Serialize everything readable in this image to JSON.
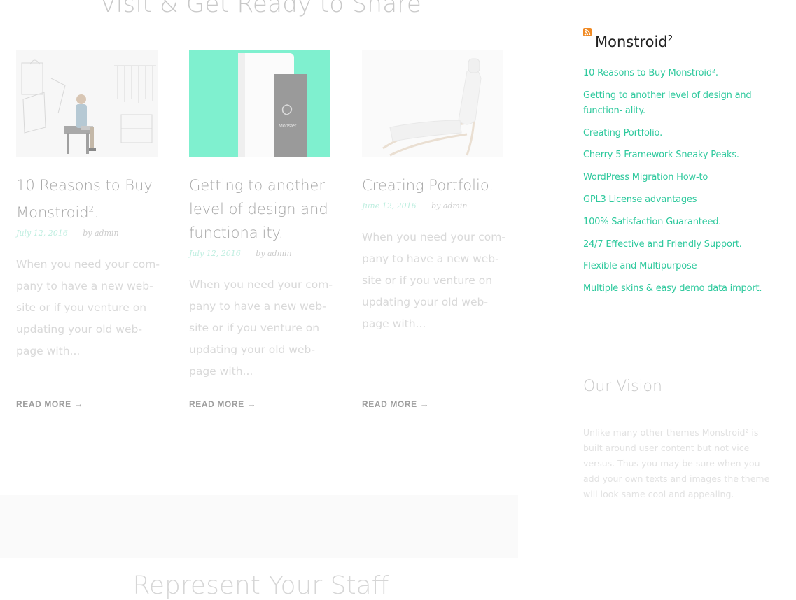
{
  "main": {
    "section_title": "Visit & Get Ready to Share",
    "next_section_title": "Represent Your Staff",
    "posts": [
      {
        "title": "10 Reasons to Buy Monstroid",
        "title_sup": "2",
        "title_suffix": ".",
        "date": "July 12, 2016",
        "author": "by admin",
        "excerpt": "When you need your com- pany to have a new web- site or if you venture on updating your old web- page with...",
        "read_more": "READ MORE"
      },
      {
        "title": "Getting to another level of design and functionality.",
        "date": "July 12, 2016",
        "author": "by admin",
        "excerpt": "When you need your com- pany to have a new web- site or if you venture on updating your old web- page with...",
        "read_more": "READ MORE"
      },
      {
        "title": "Creating Portfolio.",
        "date": "June 12, 2016",
        "author": "by admin",
        "excerpt": "When you need your com- pany to have a new web- site or if you venture on updating your old web- page with...",
        "read_more": "READ MORE"
      }
    ],
    "thumb2_brand": "Monster"
  },
  "sidebar": {
    "feed_title": "Monstroid",
    "feed_title_sup": "2",
    "feed_items": [
      "10 Reasons to Buy Monstroid².",
      "Getting to another level of design and function- ality.",
      "Creating Portfolio.",
      "Cherry 5 Framework Sneaky Peaks.",
      "WordPress Migration How-to",
      "GPL3 License advantages",
      "100% Satisfaction Guaranteed.",
      "24/7 Effective and Friendly Support.",
      "Flexible and Multipurpose",
      "Multiple skins & easy demo data import."
    ],
    "vision_title": "Our Vision",
    "vision_text": "Unlike many other themes Monstroid² is built around user content but not vice versus. Thus you may be sure when you add your own texts and images the theme will look same cool and appealing."
  },
  "colors": {
    "accent": "#2ec99d",
    "rss": "#f08a24",
    "thumb2_bg": "#7ff0cf"
  }
}
